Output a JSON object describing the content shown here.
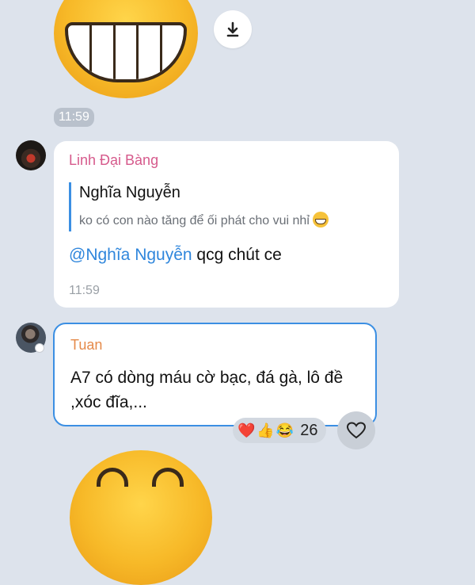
{
  "sticker_top": {
    "icon": "grinning-face-sticker"
  },
  "download": {
    "icon": "download-icon"
  },
  "sticker_time": "11:59",
  "messages": [
    {
      "sender": "Linh Đại Bàng",
      "sender_color": "#d65a8c",
      "avatar": "avatar-linh",
      "reply": {
        "name": "Nghĩa Nguyễn",
        "text": "ko có con nào tăng để ối phát cho vui nhỉ"
      },
      "mention": "@Nghĩa Nguyễn",
      "text": " qcg chút ce",
      "time": "11:59"
    },
    {
      "sender": "Tuan",
      "sender_color": "#e58a4a",
      "avatar": "avatar-tuan",
      "text": "A7 có dòng máu cờ bạc, đá gà, lô đề ,xóc đĩa,...",
      "reactions": {
        "emojis": [
          "❤️",
          "👍",
          "😂"
        ],
        "count": "26"
      }
    }
  ],
  "like_button": {
    "icon": "heart-outline-icon"
  },
  "sticker_bottom": {
    "icon": "grinning-face-sticker"
  }
}
